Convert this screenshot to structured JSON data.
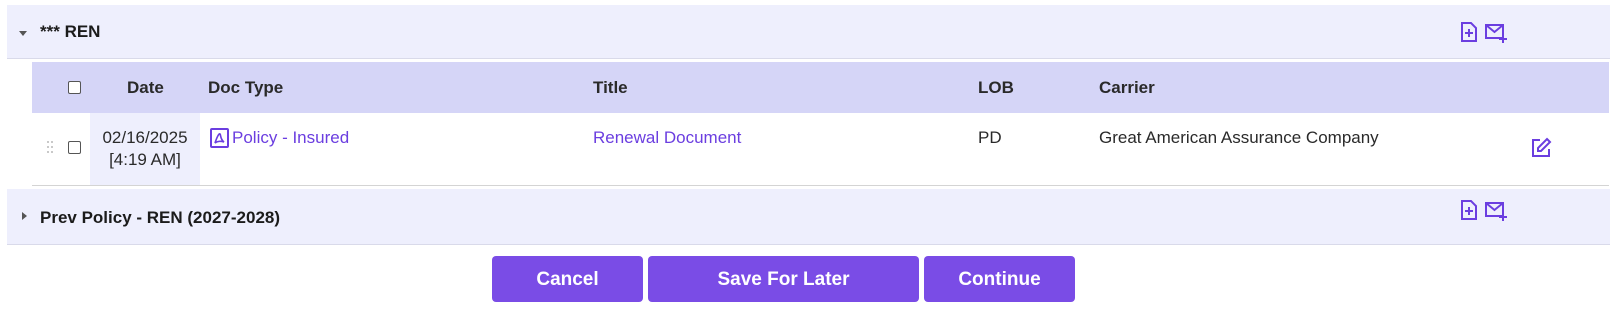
{
  "groups": [
    {
      "title": "*** REN",
      "expanded": true
    },
    {
      "title": "Prev Policy - REN (2027-2028)",
      "expanded": false
    }
  ],
  "table": {
    "headers": {
      "date": "Date",
      "doc_type": "Doc Type",
      "title": "Title",
      "lob": "LOB",
      "carrier": "Carrier"
    },
    "rows": [
      {
        "date": "02/16/2025",
        "time": "[4:19 AM]",
        "doc_type": "Policy - Insured",
        "title": "Renewal Document",
        "lob": "PD",
        "carrier": "Great American Assurance Company"
      }
    ]
  },
  "buttons": {
    "cancel": "Cancel",
    "save_for_later": "Save For Later",
    "continue": "Continue"
  },
  "icons": {
    "add_document": "add-document-icon",
    "email_add": "email-add-icon",
    "pdf": "pdf-icon",
    "edit": "edit-icon"
  },
  "colors": {
    "accent": "#7a4ce6",
    "link": "#6b3ee0",
    "header_bg": "#d5d5f7",
    "group_bg": "#eeeffd"
  }
}
